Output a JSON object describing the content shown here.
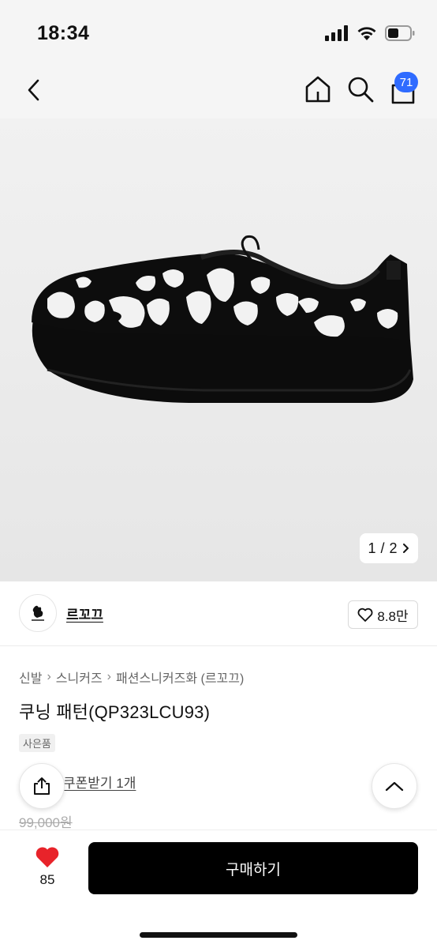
{
  "status_bar": {
    "time": "18:34",
    "icons": [
      "cellular-signal-icon",
      "wifi-icon",
      "battery-icon"
    ]
  },
  "nav": {
    "back_icon": "chevron-left-icon",
    "home_icon": "home-icon",
    "search_icon": "search-icon",
    "cart_icon": "shopping-bag-icon",
    "cart_badge": "71",
    "badge_color": "#2f6bff"
  },
  "gallery": {
    "current": "1",
    "separator": "/",
    "total": "2"
  },
  "brand": {
    "name": "르꼬끄",
    "like_count": "8.8만"
  },
  "product": {
    "breadcrumb": [
      "신발",
      "스니커즈",
      "패션스니커즈화 (르꼬끄)"
    ],
    "title": "쿠닝 패턴(QP323LCU93)",
    "gift_tag": "사은품",
    "coupon_text": "쿠폰받기 1개",
    "original_price": "99,000원"
  },
  "bottom_bar": {
    "wish_count": "85",
    "buy_label": "구매하기",
    "heart_color": "#e8232a",
    "button_color": "#000000"
  }
}
